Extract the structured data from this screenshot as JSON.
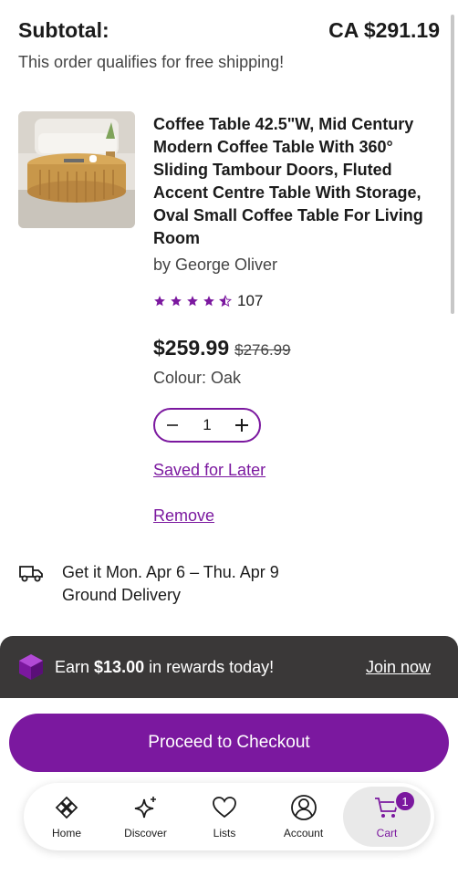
{
  "summary": {
    "subtotal_label": "Subtotal:",
    "subtotal_value": "CA $291.19",
    "shipping_note": "This order qualifies for free shipping!"
  },
  "product": {
    "title": "Coffee Table 42.5\"W, Mid Century Modern Coffee Table With 360° Sliding Tambour Doors, Fluted Accent Centre Table With Storage, Oval Small Coffee Table For Living Room",
    "brand": "by George Oliver",
    "rating_value": 4.5,
    "rating_count": "107",
    "price_current": "$259.99",
    "price_was": "$276.99",
    "colour": "Colour: Oak",
    "quantity": "1",
    "saved_for_later": "Saved for Later",
    "remove": "Remove"
  },
  "delivery": {
    "line1": "Get it Mon. Apr 6 – Thu. Apr 9",
    "line2": "Ground Delivery"
  },
  "rewards": {
    "prefix": "Earn ",
    "amount": "$13.00",
    "suffix": " in rewards today!",
    "join": "Join now"
  },
  "checkout": {
    "label": "Proceed to Checkout"
  },
  "nav": {
    "items": [
      {
        "label": "Home",
        "icon": "home-icon"
      },
      {
        "label": "Discover",
        "icon": "sparkle-icon"
      },
      {
        "label": "Lists",
        "icon": "heart-icon"
      },
      {
        "label": "Account",
        "icon": "user-icon"
      },
      {
        "label": "Cart",
        "icon": "cart-icon",
        "badge": "1"
      }
    ]
  },
  "colors": {
    "accent": "#7b189f",
    "rewards_bar": "#3a3838"
  }
}
